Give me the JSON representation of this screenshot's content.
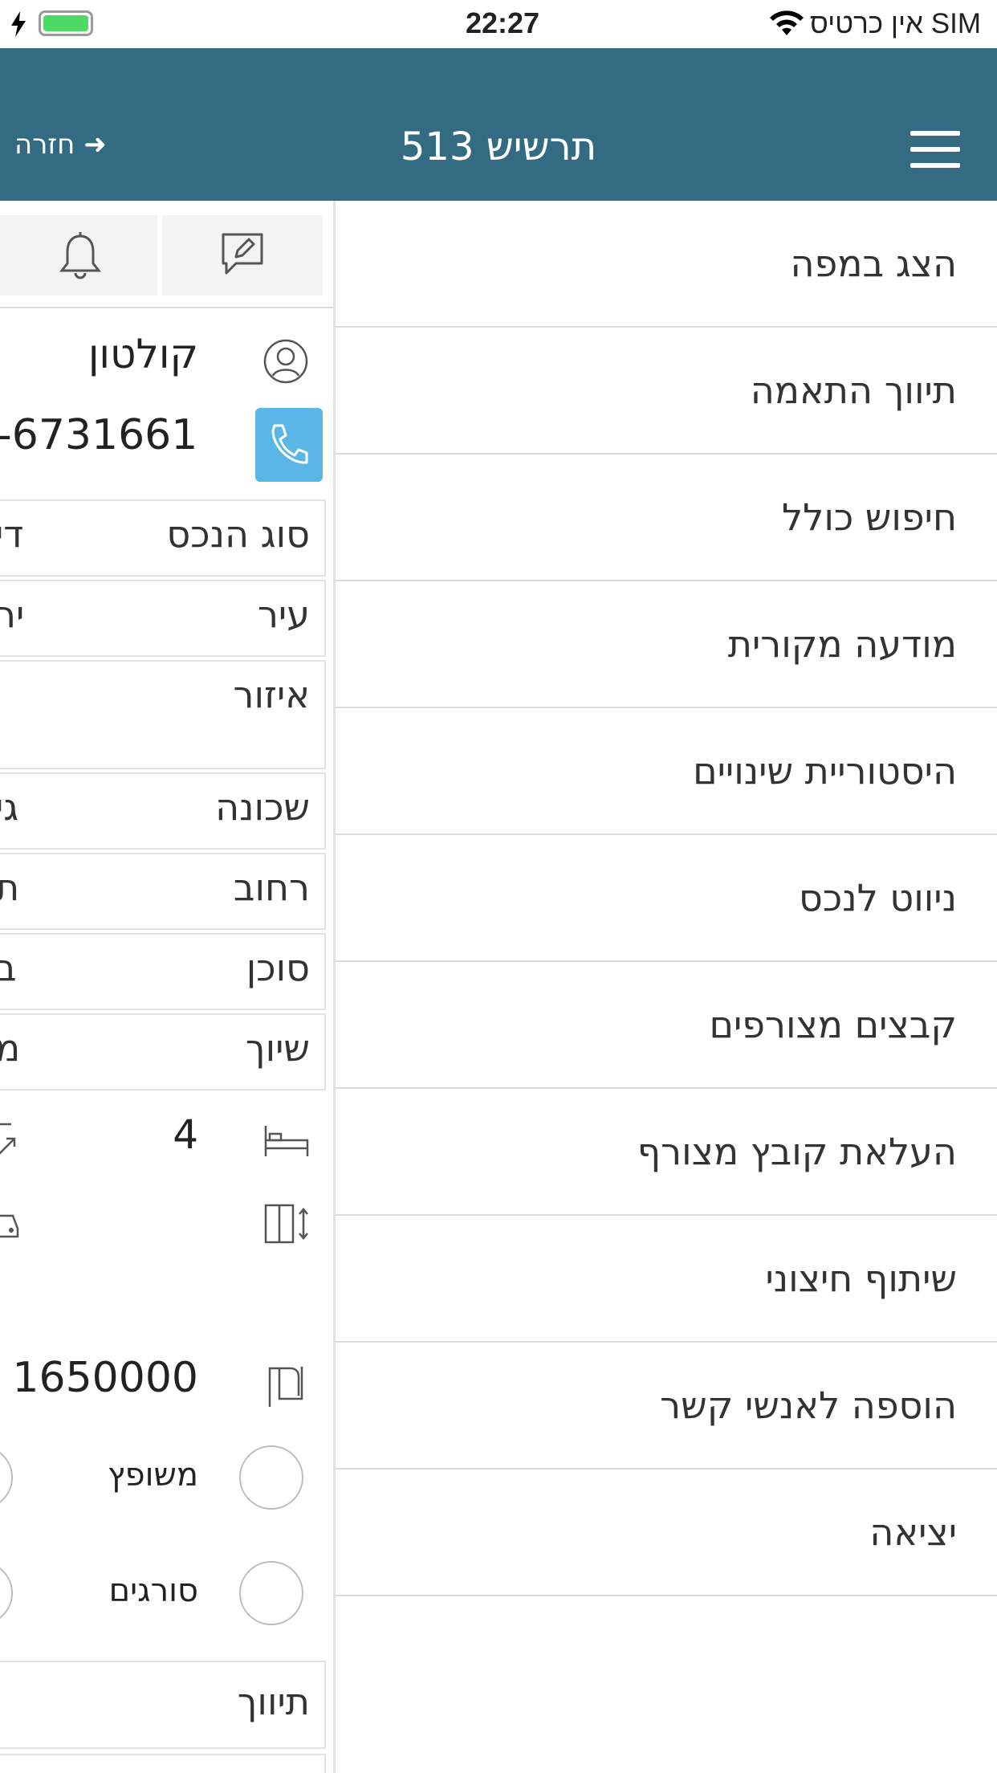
{
  "status_bar": {
    "time": "22:27",
    "carrier": "אין כרטיס SIM",
    "battery_color": "#4cd964"
  },
  "header": {
    "title": "תרשיש 513",
    "back_label": "חזרה ➜",
    "menu_icon": "hamburger-icon",
    "background": "#326b82"
  },
  "side_menu": {
    "items": [
      "הצג במפה",
      "תיווך התאמה",
      "חיפוש כולל",
      "מודעה מקורית",
      "היסטוריית שינויים",
      "ניווט לנכס",
      "קבצים מצורפים",
      "העלאת קובץ מצורף",
      "שיתוף חיצוני",
      "הוספה לאנשי קשר",
      "יציאה"
    ]
  },
  "listing": {
    "toolbar": {
      "edit_icon": "edit-comment-icon",
      "bell_icon": "bell-icon"
    },
    "contact_name": "קולטון",
    "phone": "-6731661",
    "phone_button_color": "#5bb6e8",
    "fields": [
      {
        "label": "סוג הנכס",
        "value": "די"
      },
      {
        "label": "עיר",
        "value": "יר"
      },
      {
        "label": "איזור",
        "value": ""
      },
      {
        "label": "שכונה",
        "value": "גי"
      },
      {
        "label": "רחוב",
        "value": "ת"
      },
      {
        "label": "סוכן",
        "value": "ב"
      },
      {
        "label": "שיוך",
        "value": "מ"
      }
    ],
    "rooms": "4",
    "price": "1650000",
    "options": [
      "משופץ",
      "סורגים"
    ],
    "tivuch_label": "תיווך"
  }
}
